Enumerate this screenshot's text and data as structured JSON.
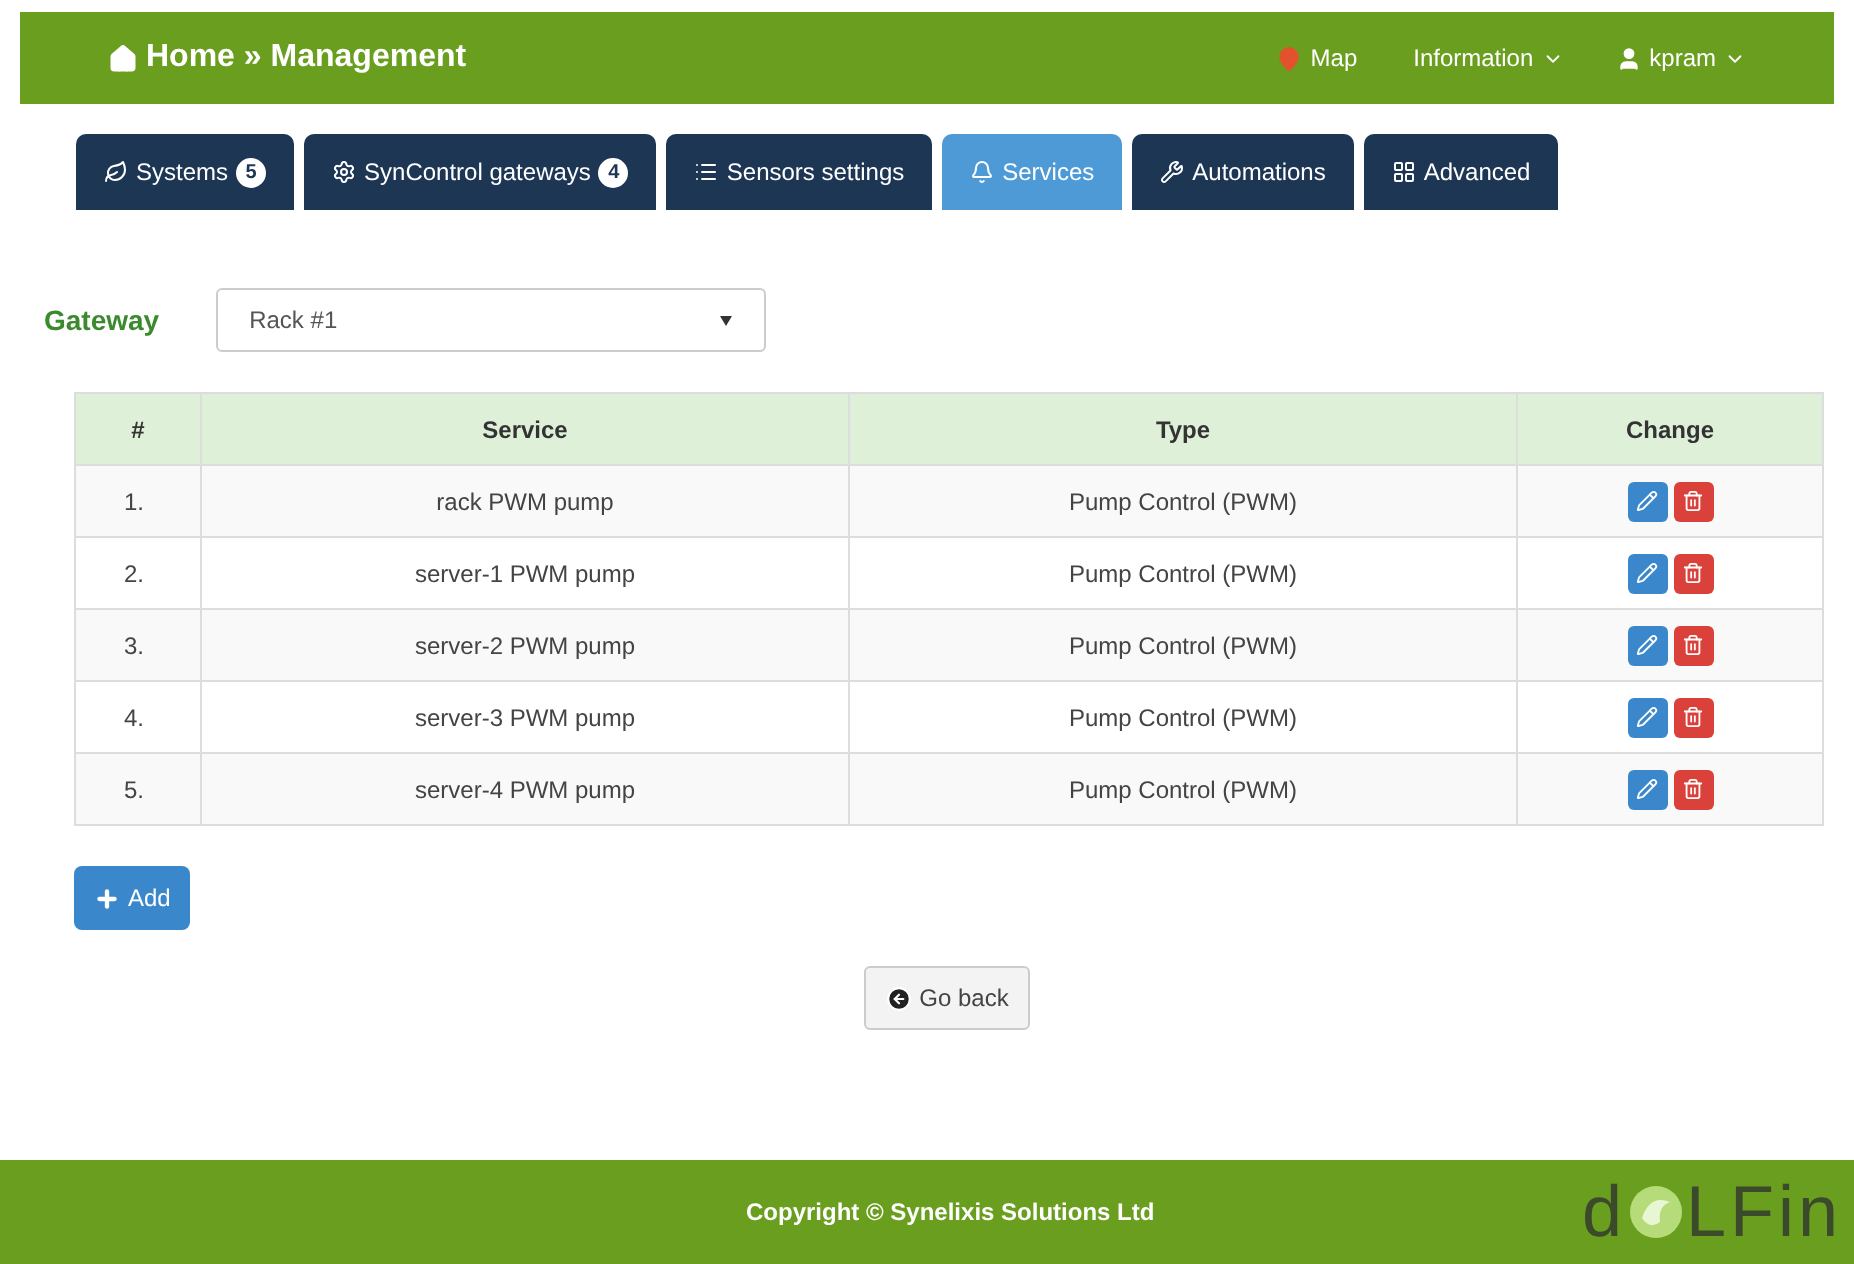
{
  "navbar": {
    "brand_home": "Home",
    "brand_separator": "»",
    "brand_section": "Management",
    "links": [
      {
        "kind": "map",
        "label": "Map"
      },
      {
        "kind": "dropdown",
        "label": "Information"
      },
      {
        "kind": "user",
        "label": "kpram"
      }
    ]
  },
  "tabs": [
    {
      "label": "Systems",
      "badge": "5",
      "selected": false
    },
    {
      "label": "SynControl gateways",
      "badge": "4",
      "selected": false
    },
    {
      "label": "Sensors settings",
      "selected": false
    },
    {
      "label": "Services",
      "selected": true
    },
    {
      "label": "Automations",
      "selected": false
    },
    {
      "label": "Advanced",
      "selected": false
    }
  ],
  "gateway": {
    "label": "Gateway",
    "value": "Rack #1"
  },
  "table": {
    "columns": [
      "#",
      "Service",
      "Type",
      "Change"
    ],
    "rows": [
      {
        "index": "1.",
        "service": "rack PWM pump",
        "type": "Pump Control (PWM)"
      },
      {
        "index": "2.",
        "service": "server-1 PWM pump",
        "type": "Pump Control (PWM)"
      },
      {
        "index": "3.",
        "service": "server-2 PWM pump",
        "type": "Pump Control (PWM)"
      },
      {
        "index": "4.",
        "service": "server-3 PWM pump",
        "type": "Pump Control (PWM)"
      },
      {
        "index": "5.",
        "service": "server-4 PWM pump",
        "type": "Pump Control (PWM)"
      }
    ]
  },
  "add_button": "Add",
  "back_button": "Go back",
  "footer": {
    "copyright": "Copyright © Synelixis Solutions Ltd",
    "logo_start": "d",
    "logo_end": "LFin"
  }
}
